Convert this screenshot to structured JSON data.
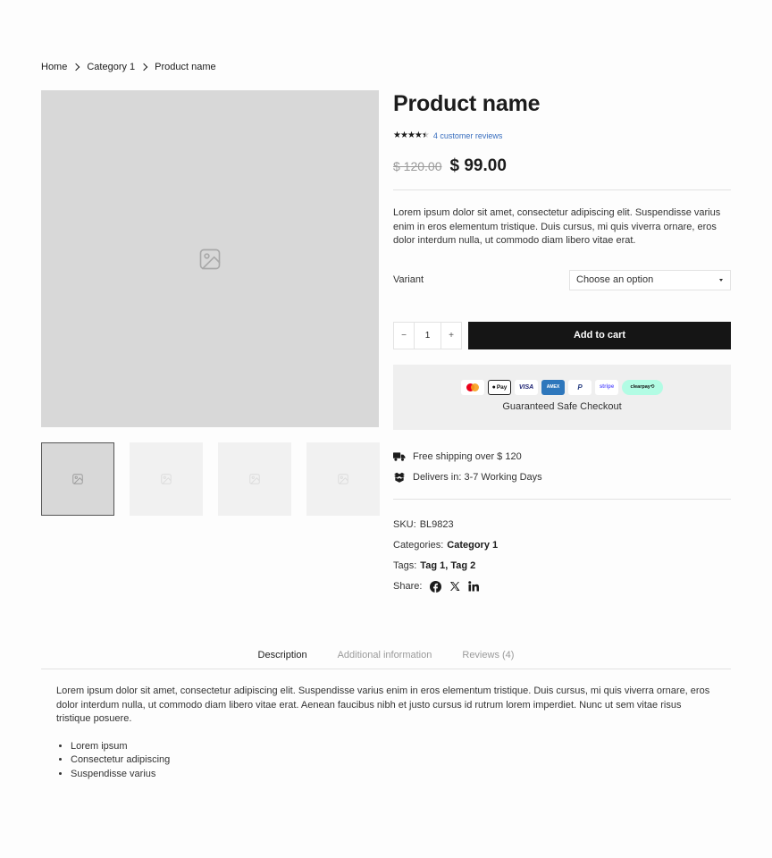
{
  "breadcrumb": {
    "home": "Home",
    "category": "Category 1",
    "current": "Product name"
  },
  "product": {
    "title": "Product name",
    "rating_stars": 4.5,
    "reviews_link": "4 customer reviews",
    "old_price": "$ 120.00",
    "new_price": "$ 99.00",
    "description": "Lorem ipsum dolor sit amet, consectetur adipiscing elit. Suspendisse varius enim in eros elementum tristique. Duis cursus, mi quis viverra ornare, eros dolor interdum nulla, ut commodo diam libero vitae erat."
  },
  "variant": {
    "label": "Variant",
    "selected": "Choose an option"
  },
  "cart": {
    "quantity": "1",
    "minus": "−",
    "plus": "+",
    "add_to_cart": "Add to cart"
  },
  "checkout": {
    "payment_icons": [
      "mastercard-icon",
      "applepay-icon",
      "visa-icon",
      "amex-icon",
      "paypal-icon",
      "stripe-icon",
      "clearpay-icon"
    ],
    "applepay": "Pay",
    "visa": "VISA",
    "amex": "AMEX",
    "paypal": "P",
    "stripe": "stripe",
    "clearpay": "clearpay⟲",
    "label": "Guaranteed Safe Checkout"
  },
  "shipping": {
    "free": "Free shipping over $ 120",
    "delivers": "Delivers in: 3-7 Working Days"
  },
  "meta": {
    "sku_label": "SKU:",
    "sku_value": "BL9823",
    "categories_label": "Categories:",
    "categories_value": "Category 1",
    "tags_label": "Tags:",
    "tags_value": "Tag 1, Tag 2",
    "share_label": "Share:",
    "share_icons": [
      "facebook-icon",
      "x-icon",
      "linkedin-icon"
    ]
  },
  "tabs": [
    {
      "label": "Description",
      "active": true
    },
    {
      "label": "Additional information",
      "active": false
    },
    {
      "label": "Reviews (4)",
      "active": false
    }
  ],
  "tab_content": {
    "paragraph": "Lorem ipsum dolor sit amet, consectetur adipiscing elit. Suspendisse varius enim in eros elementum tristique. Duis cursus, mi quis viverra ornare, eros dolor interdum nulla, ut commodo diam libero vitae erat. Aenean faucibus nibh et justo cursus id rutrum lorem imperdiet. Nunc ut sem vitae risus tristique posuere.",
    "list": [
      "Lorem ipsum",
      "Consectetur adipiscing",
      "Suspendisse varius"
    ]
  },
  "colors": {
    "accent": "#151515",
    "link": "#3a6fbf",
    "image_placeholder": "#d8d8d8",
    "checkout_bg": "#efefef"
  }
}
